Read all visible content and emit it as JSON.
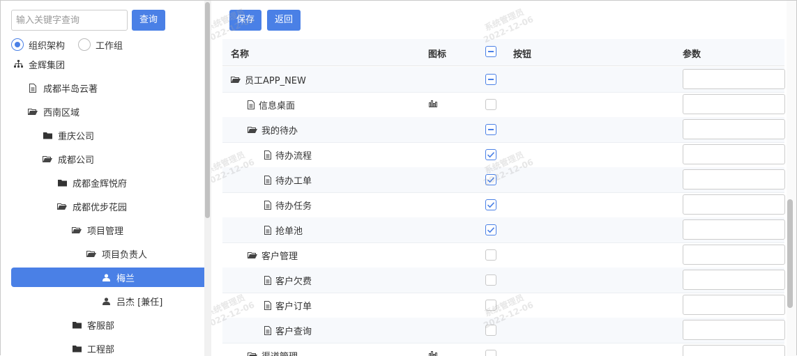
{
  "search": {
    "placeholder": "输入关键字查询",
    "button": "查询"
  },
  "radios": [
    {
      "label": "组织架构",
      "checked": true
    },
    {
      "label": "工作组",
      "checked": false
    }
  ],
  "tree": [
    {
      "label": "金辉集团",
      "icon": "org-tree-icon",
      "level": 0
    },
    {
      "label": "成都半岛云著",
      "icon": "file-icon",
      "level": 1
    },
    {
      "label": "西南区域",
      "icon": "folder-open-icon",
      "level": 1
    },
    {
      "label": "重庆公司",
      "icon": "folder-icon",
      "level": 2
    },
    {
      "label": "成都公司",
      "icon": "folder-open-icon",
      "level": 2
    },
    {
      "label": "成都金辉悦府",
      "icon": "folder-icon",
      "level": 3
    },
    {
      "label": "成都优步花园",
      "icon": "folder-open-icon",
      "level": 3
    },
    {
      "label": "项目管理",
      "icon": "folder-open-icon",
      "level": 4
    },
    {
      "label": "项目负责人",
      "icon": "folder-open-icon",
      "level": 5
    },
    {
      "label": "梅兰",
      "icon": "user-icon",
      "level": 6,
      "selected": true
    },
    {
      "label": "吕杰 [兼任]",
      "icon": "user-icon",
      "level": 6
    },
    {
      "label": "客服部",
      "icon": "folder-icon",
      "level": 4
    },
    {
      "label": "工程部",
      "icon": "folder-icon",
      "level": 4
    }
  ],
  "toolbar": {
    "save": "保存",
    "back": "返回"
  },
  "columns": {
    "name": "名称",
    "icon": "图标",
    "buttons": "按钮",
    "params": "参数"
  },
  "rows": [
    {
      "name": "员工APP_NEW",
      "icon": "folder-open-icon",
      "level": 0,
      "check": "mixed",
      "col_icon": ""
    },
    {
      "name": "信息桌面",
      "icon": "file-icon",
      "level": 1,
      "check": "off",
      "col_icon": "bar-chart-icon"
    },
    {
      "name": "我的待办",
      "icon": "folder-open-icon",
      "level": 1,
      "check": "mixed",
      "col_icon": ""
    },
    {
      "name": "待办流程",
      "icon": "file-icon",
      "level": 2,
      "check": "on",
      "col_icon": ""
    },
    {
      "name": "待办工单",
      "icon": "file-icon",
      "level": 2,
      "check": "on",
      "col_icon": ""
    },
    {
      "name": "待办任务",
      "icon": "file-icon",
      "level": 2,
      "check": "on",
      "col_icon": ""
    },
    {
      "name": "抢单池",
      "icon": "file-icon",
      "level": 2,
      "check": "on",
      "col_icon": ""
    },
    {
      "name": "客户管理",
      "icon": "folder-open-icon",
      "level": 1,
      "check": "off",
      "col_icon": ""
    },
    {
      "name": "客户欠费",
      "icon": "file-icon",
      "level": 2,
      "check": "off",
      "col_icon": ""
    },
    {
      "name": "客户订单",
      "icon": "file-icon",
      "level": 2,
      "check": "off",
      "col_icon": ""
    },
    {
      "name": "客户查询",
      "icon": "file-icon",
      "level": 2,
      "check": "off",
      "col_icon": ""
    },
    {
      "name": "渠道管理",
      "icon": "folder-open-icon",
      "level": 1,
      "check": "off",
      "col_icon": "bar-chart-icon"
    }
  ],
  "watermark": {
    "user": "系统管理员",
    "date": "2022-12-06"
  },
  "colors": {
    "accent": "#4a80e6",
    "header_bg": "#f7f9fc"
  }
}
